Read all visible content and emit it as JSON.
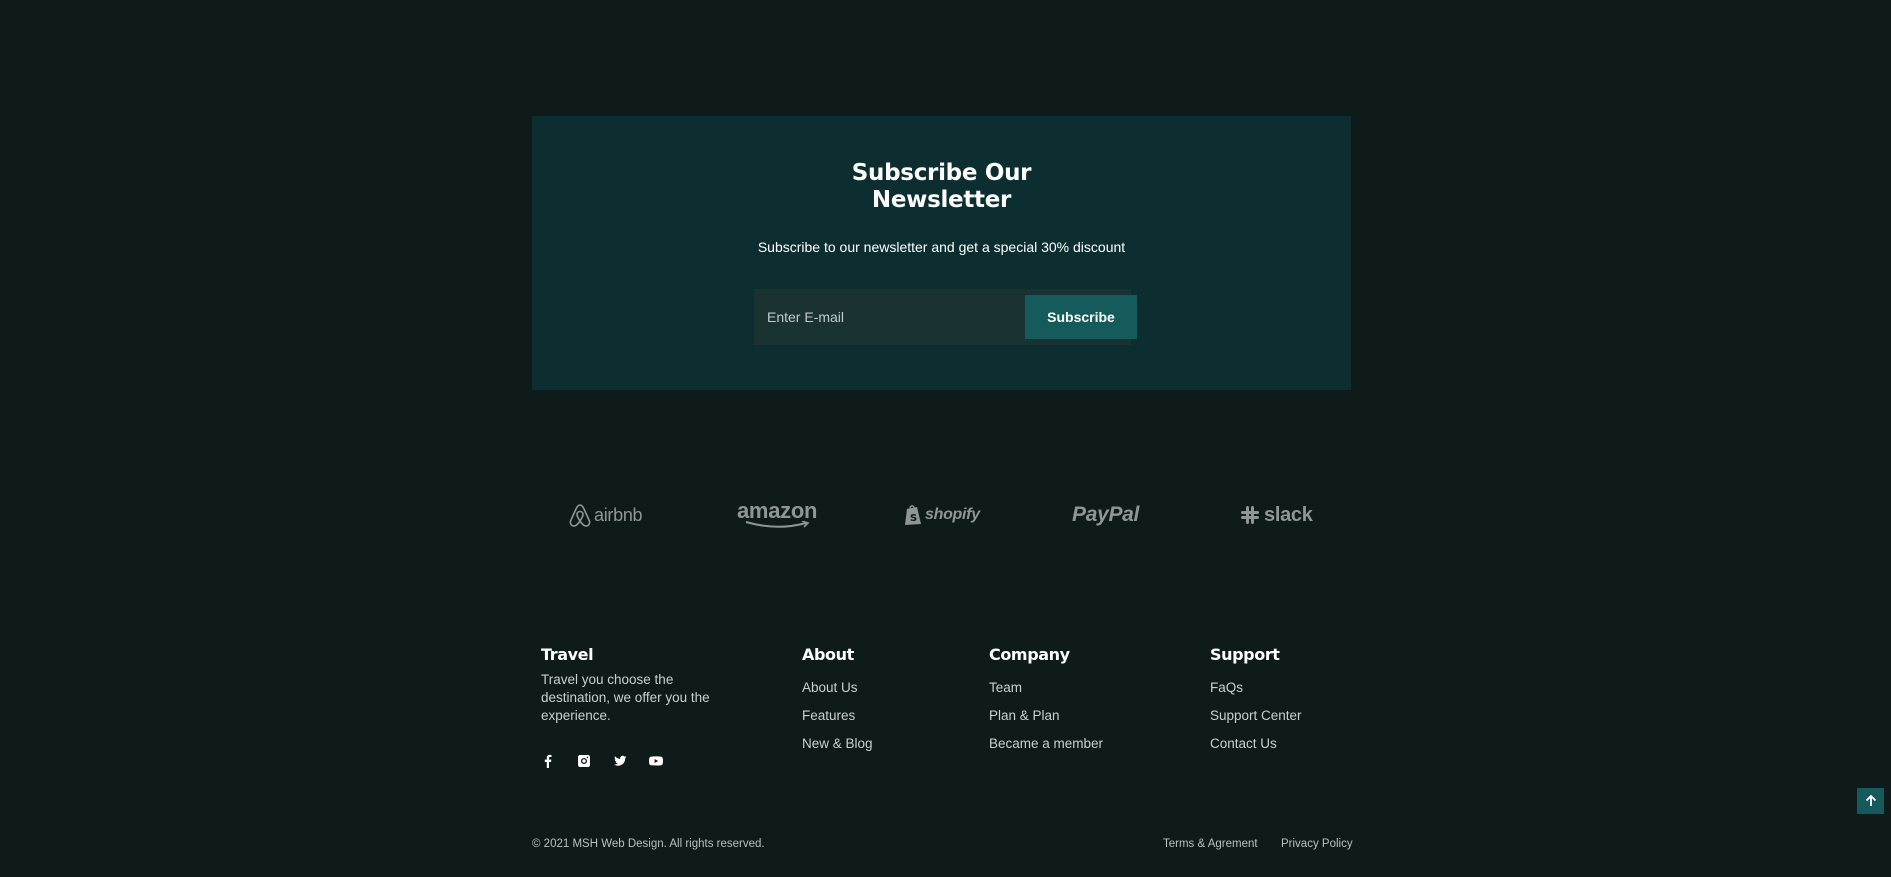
{
  "newsletter": {
    "title_line1": "Subscribe Our",
    "title_line2": "Newsletter",
    "subtitle": "Subscribe to our newsletter and get a special 30% discount",
    "email_placeholder": "Enter E-mail",
    "button_label": "Subscribe"
  },
  "brands": [
    "airbnb",
    "amazon",
    "shopify",
    "PayPal",
    "slack"
  ],
  "footer": {
    "travel": {
      "title": "Travel",
      "description": "Travel you choose the destination, we offer you the experience.",
      "socials": [
        "facebook-icon",
        "instagram-icon",
        "twitter-icon",
        "youtube-icon"
      ]
    },
    "about": {
      "title": "About",
      "links": [
        "About Us",
        "Features",
        "New & Blog"
      ]
    },
    "company": {
      "title": "Company",
      "links": [
        "Team",
        "Plan & Plan",
        "Became a member"
      ]
    },
    "support": {
      "title": "Support",
      "links": [
        "FaQs",
        "Support Center",
        "Contact Us"
      ]
    }
  },
  "bottom": {
    "copyright": "© 2021 MSH Web Design. All rights reserved.",
    "terms": "Terms & Agrement",
    "privacy": "Privacy Policy"
  },
  "colors": {
    "background": "#0f1a1b",
    "newsletter_bg": "#0d2e31",
    "accent": "#155b5c",
    "muted_text": "#c9d0d0",
    "logo_gray": "#8f9696"
  },
  "icons": {
    "scroll_top": "arrow-up-icon"
  }
}
